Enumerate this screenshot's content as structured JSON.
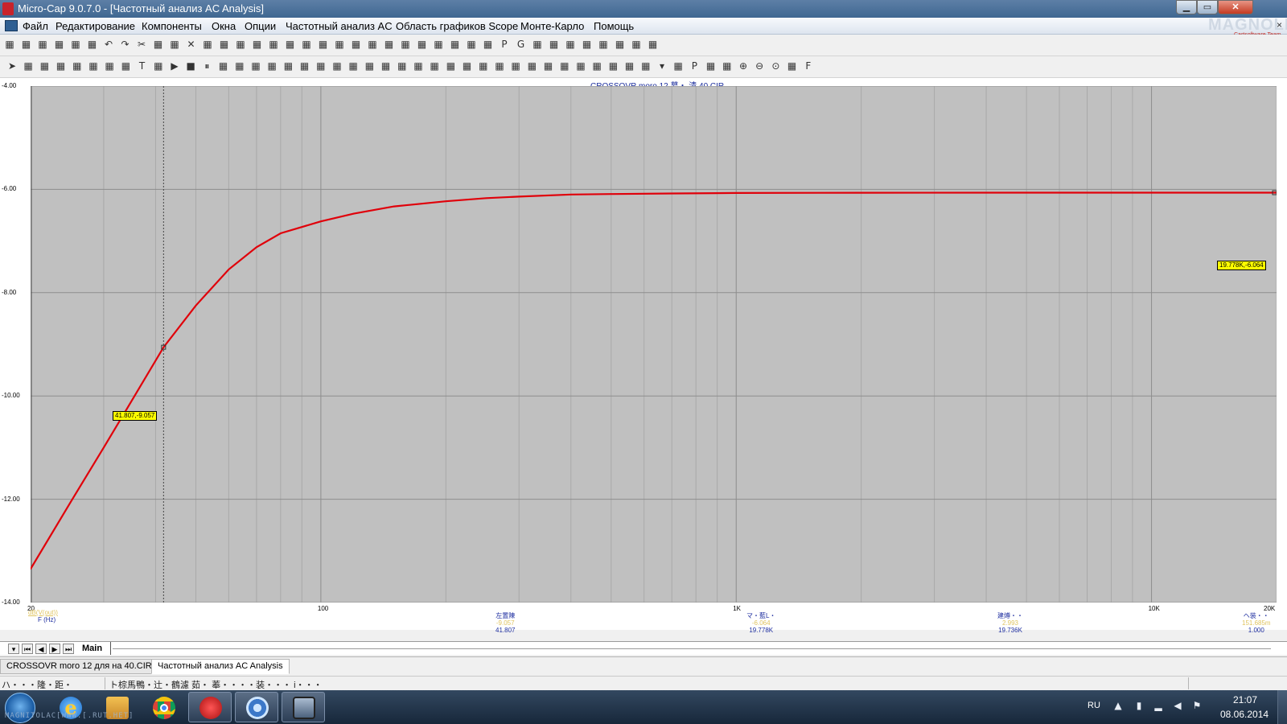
{
  "window": {
    "title": "Micro-Cap 9.0.7.0 - [Частотный анализ AC Analysis]",
    "minimize": "▁",
    "maximize": "▭",
    "close": "✕"
  },
  "menu": [
    "Файл",
    "Редактирование",
    "Компоненты",
    "Окна",
    "Опции",
    "Частотный анализ AC",
    "Область графиков Scope",
    "Монте-Карло",
    "Помощь"
  ],
  "mdi_close": "×",
  "brand": {
    "logo": "MAGNOLIA",
    "sub": "Cartsoftware Team"
  },
  "toolbar1_icons": [
    "new-icon",
    "open-icon",
    "save-icon",
    "save-all-icon",
    "print-icon",
    "print-preview-icon",
    "undo-icon",
    "redo-icon",
    "cut-icon",
    "copy-icon",
    "paste-icon",
    "delete-icon",
    "select-all-icon",
    "wire-icon",
    "ground-icon",
    "resistor-icon",
    "capacitor-icon",
    "inductor-icon",
    "diode-icon",
    "battery-icon",
    "source-icon",
    "npn-icon",
    "opamp-icon",
    "switch-icon",
    "tile-horizontal-icon",
    "tile-vertical-icon",
    "cascade-icon",
    "window-icon",
    "split-icon",
    "calculator-icon",
    "p-icon",
    "g-icon",
    "blank-icon",
    "netlist-icon",
    "numeric-icon",
    "probe-icon",
    "pen-icon",
    "scope-icon",
    "text-icon",
    "info-icon"
  ],
  "toolbar2_icons": [
    "pointer-icon",
    "wire-tool-icon",
    "step-icon",
    "scale-icon",
    "range-icon",
    "limits-icon",
    "trace-icon",
    "tag-icon",
    "text-tool-icon",
    "export-icon",
    "run-icon",
    "stop-icon",
    "pause-icon",
    "line-icon",
    "arrow-icon",
    "grid-icon",
    "minor-grid-icon",
    "panel1-icon",
    "panel2-icon",
    "panel3-icon",
    "panel4-icon",
    "panel5-icon",
    "cursor-icon",
    "peak-icon",
    "valley-icon",
    "high-icon",
    "low-icon",
    "box-icon",
    "left-cursor-icon",
    "right-cursor-icon",
    "peak-curs-icon",
    "valley-curs-icon",
    "slope-icon",
    "inflection-icon",
    "global-high-icon",
    "global-low-icon",
    "point-icon",
    "top-icon",
    "bottom-icon",
    "chip-icon",
    "dropdown-icon",
    "table-icon",
    "p-tag-icon",
    "cursor-left-icon",
    "cursor-right-icon",
    "zoom-in-icon",
    "zoom-out-icon",
    "zoom-fit-icon",
    "hand-icon",
    "f-icon"
  ],
  "plot": {
    "title": "CROSSOVR moro 12 墓・ 清 40.CIR",
    "y_ticks": [
      "-4.00",
      "-6.00",
      "-8.00",
      "-10.00",
      "-12.00",
      "-14.00"
    ],
    "x_ticks": [
      "20",
      "100",
      "1K",
      "10K",
      "20K"
    ],
    "trace_legend": "dB(V(out))",
    "axis_title": "F (Hz)",
    "left_cursor_tag": "41.807,-9.057",
    "right_cursor_tag": "19.778K,-6.064"
  },
  "readouts": [
    {
      "name": "左置陳",
      "sub": "-9.057",
      "val": "41.807"
    },
    {
      "name": "マ・藍L・",
      "sub": "-6.064",
      "val": "19.778K"
    },
    {
      "name": "建燇・・",
      "sub": "2.993",
      "val": "19.736K"
    },
    {
      "name": "ヘ装・・",
      "sub": "151.685m",
      "val": "1.000"
    }
  ],
  "chart_data": {
    "type": "line",
    "title": "CROSSOVR moro 12 墓・ 清 40.CIR",
    "xlabel": "F (Hz)",
    "ylabel": "",
    "xscale": "log",
    "xlim": [
      20,
      20000
    ],
    "ylim": [
      -14,
      -4
    ],
    "grid": true,
    "series": [
      {
        "name": "dB(V(out))",
        "color": "#e0000a",
        "x": [
          20,
          25,
          30,
          35,
          41.807,
          50,
          60,
          70,
          80,
          100,
          120,
          150,
          200,
          250,
          300,
          400,
          500,
          700,
          1000,
          2000,
          5000,
          10000,
          20000
        ],
        "y": [
          -13.35,
          -12.05,
          -11.0,
          -10.1,
          -9.057,
          -8.25,
          -7.55,
          -7.12,
          -6.85,
          -6.62,
          -6.47,
          -6.33,
          -6.23,
          -6.17,
          -6.14,
          -6.1,
          -6.09,
          -6.08,
          -6.07,
          -6.065,
          -6.064,
          -6.064,
          -6.064
        ]
      }
    ],
    "cursors": [
      {
        "x": 41.807,
        "y": -9.057
      },
      {
        "x": 19778,
        "y": -6.064
      }
    ]
  },
  "page_nav": {
    "tab": "Main"
  },
  "doc_tabs": [
    "CROSSOVR moro 12 для на 40.CIR",
    "Частотный анализ AC Analysis"
  ],
  "status": {
    "left": "ハ・・・隆・距・",
    "middle": "ト棕馬鴨・辻・鶴濾 茹・ 菶・・・・装・・・ i・・・"
  },
  "taskbar": {
    "watermark": "MAGNITOLAС[WWW.[.RUТ.НЕТ]",
    "lang": "RU",
    "time": "21:07",
    "date": "08.06.2014"
  }
}
